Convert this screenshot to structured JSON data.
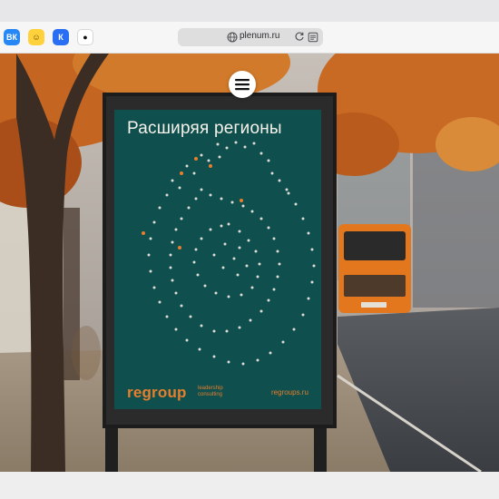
{
  "browser": {
    "url": "plenum.ru",
    "tabs": [
      {
        "label": "ВК",
        "icon": "vk-icon"
      },
      {
        "label": "☺",
        "icon": "smile-icon"
      },
      {
        "label": "К",
        "icon": "k-icon"
      },
      {
        "label": "●",
        "icon": "ok-icon"
      }
    ]
  },
  "poster": {
    "title": "Расширяя регионы",
    "brand": "regroup",
    "tagline_1": "leadership",
    "tagline_2": "consulting",
    "website": "regroups.ru"
  },
  "colors": {
    "poster_bg": "#0f4f4e",
    "accent": "#e67f2d",
    "text_light": "#f6f2ea"
  }
}
